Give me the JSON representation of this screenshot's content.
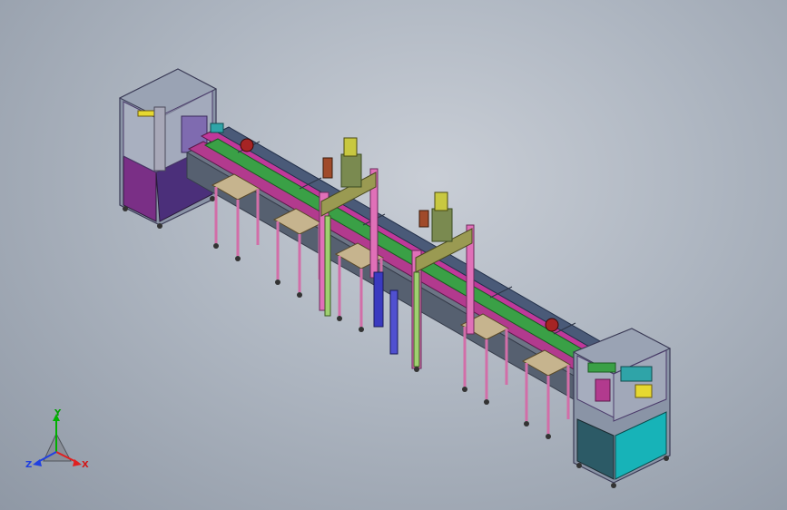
{
  "triad": {
    "y_label": "Y",
    "x_label": "X",
    "z_label": "Z",
    "y_color": "#00b000",
    "x_color": "#e02020",
    "z_color": "#2040e0"
  },
  "colors": {
    "cabinet_purple": "#5a2a72",
    "cabinet_magenta": "#8e2a8c",
    "cabinet_cyan": "#17b3b8",
    "cabinet_dark": "#2c5a66",
    "frame_gray": "#6e7886",
    "rail_magenta": "#c0389a",
    "rail_green": "#3aa046",
    "table_tan": "#c6b48e",
    "column_pink": "#e070b8",
    "press_olive": "#9a9a52"
  }
}
